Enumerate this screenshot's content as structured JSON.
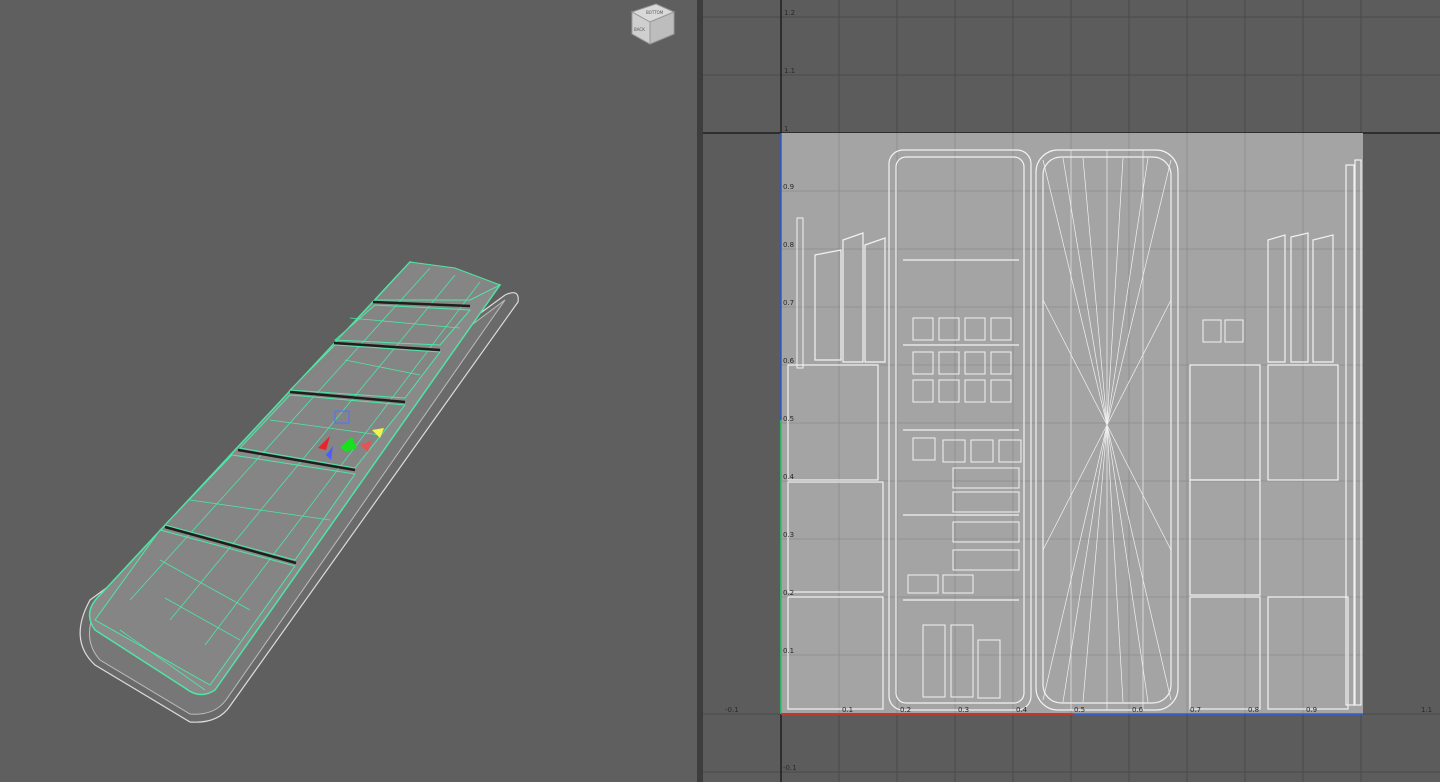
{
  "viewcube": {
    "top_label": "BOTTOM",
    "front_label": "BACK",
    "side_label": ""
  },
  "uv_axis": {
    "v_ticks": [
      "1.2",
      "1.1",
      "1",
      "0.9",
      "0.8",
      "0.7",
      "0.6",
      "0.5",
      "0.4",
      "0.3",
      "0.2",
      "0.1",
      "-0.1"
    ],
    "u_ticks": [
      "-0.1",
      "0.1",
      "0.2",
      "0.3",
      "0.4",
      "0.5",
      "0.6",
      "0.7",
      "0.8",
      "0.9",
      "1.1"
    ]
  },
  "colors": {
    "viewport_bg": "#5f5f5f",
    "uv_bg": "#5c5c5c",
    "uv_tile": "#a4a4a4",
    "wireframe": "#4ee6a6",
    "uv_shell_lines": "#f2f2f2",
    "axis_u": "#c0392b",
    "axis_v": "#2e5fd8"
  }
}
